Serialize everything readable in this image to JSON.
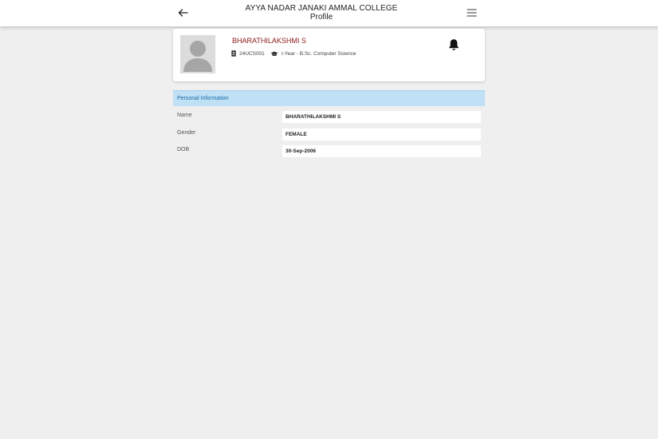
{
  "header": {
    "college_name": "AYYA NADAR JANAKI AMMAL COLLEGE",
    "page_title": "Profile",
    "icons": {
      "back": "arrow-left-icon",
      "menu": "hamburger-menu-icon"
    }
  },
  "profile": {
    "name": "BHARATHILAKSHMI S",
    "roll_no": "24UCS001",
    "course": "I-Year - B.Sc. Computer Science",
    "name_color": "#8b1a1a",
    "icons": {
      "roll": "id-badge-icon",
      "course": "graduation-cap-icon",
      "notifications": "bell-icon",
      "avatar": "user-avatar-icon"
    }
  },
  "personal_info": {
    "section_title": "Personal Information",
    "accent_color": "#bfe0f5",
    "fields": [
      {
        "label": "Name",
        "value": "BHARATHILAKSHMI S"
      },
      {
        "label": "Gender",
        "value": "FEMALE"
      },
      {
        "label": "DOB",
        "value": "30-Sep-2006"
      }
    ]
  }
}
